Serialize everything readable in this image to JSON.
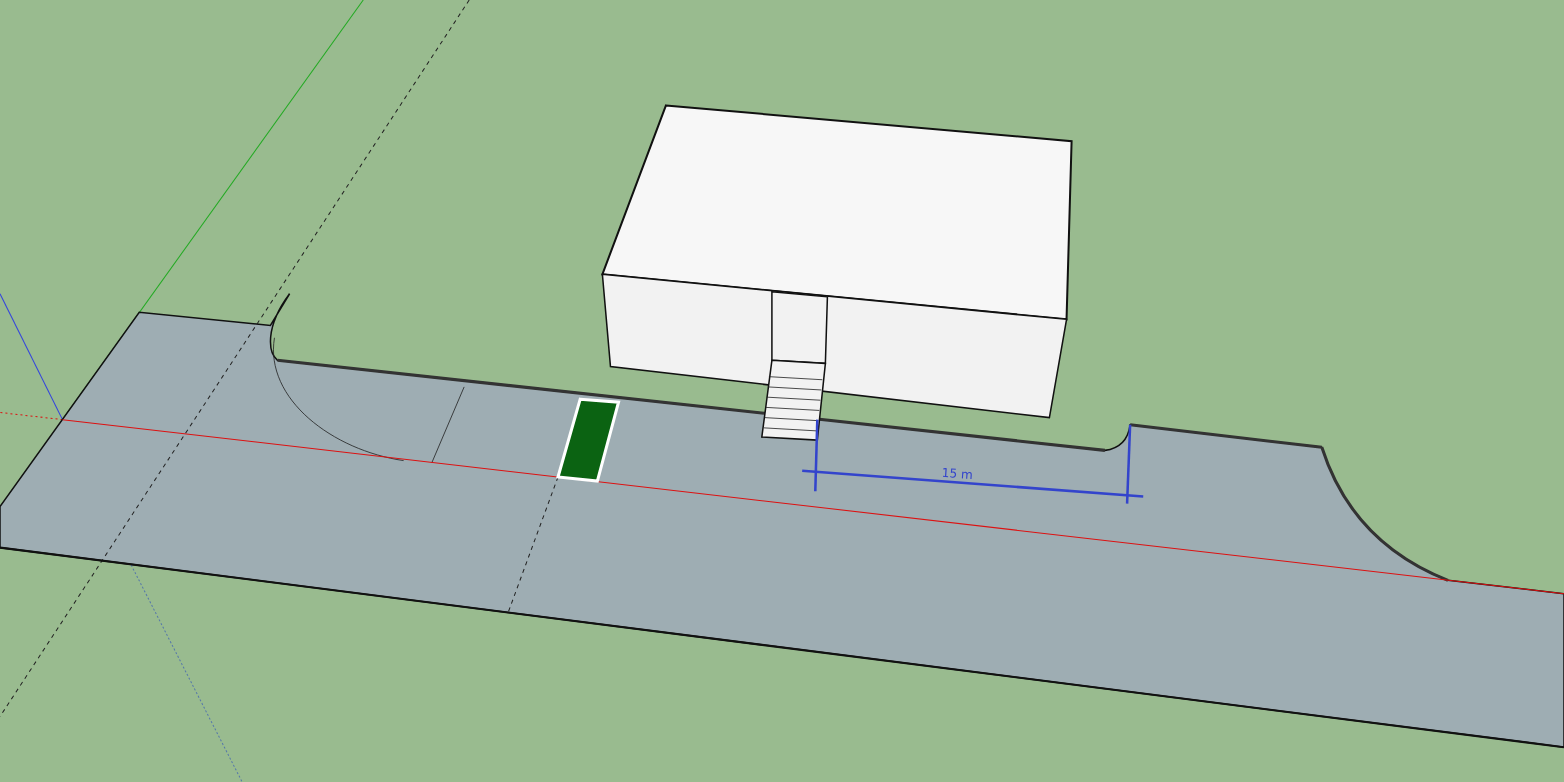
{
  "viewport": {
    "dimension": {
      "label": "15 m"
    }
  }
}
